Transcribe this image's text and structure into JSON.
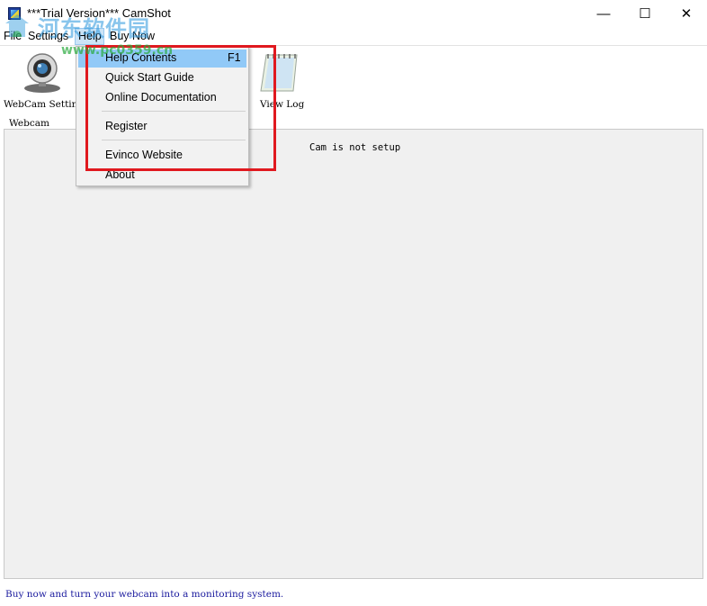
{
  "window": {
    "title": "***Trial Version*** CamShot",
    "min_glyph": "—",
    "max_glyph": "☐",
    "close_glyph": "✕"
  },
  "menubar": {
    "items": [
      {
        "label": "File"
      },
      {
        "label": "Settings"
      },
      {
        "label": "Help"
      },
      {
        "label": "Buy Now"
      }
    ]
  },
  "toolbar": {
    "webcam_settings_label": "WebCam Settin",
    "view_log_label": "View Log"
  },
  "help_menu": {
    "items": [
      {
        "label": "Help Contents",
        "shortcut": "F1"
      },
      {
        "label": "Quick Start Guide"
      },
      {
        "label": "Online Documentation"
      },
      {
        "label": "Register"
      },
      {
        "label": "Evinco Website"
      },
      {
        "label": "About"
      }
    ]
  },
  "webcam_group": {
    "label": "Webcam",
    "status": "Cam is not setup"
  },
  "statusbar": {
    "text": "Buy now and turn your webcam into a monitoring system."
  },
  "watermark": {
    "line1": "河东软件园",
    "line2": "www.pc0359.cn"
  },
  "colors": {
    "menu_highlight": "#91c9f7",
    "annotation": "#e0191f",
    "status_text": "#1a1a9e"
  }
}
